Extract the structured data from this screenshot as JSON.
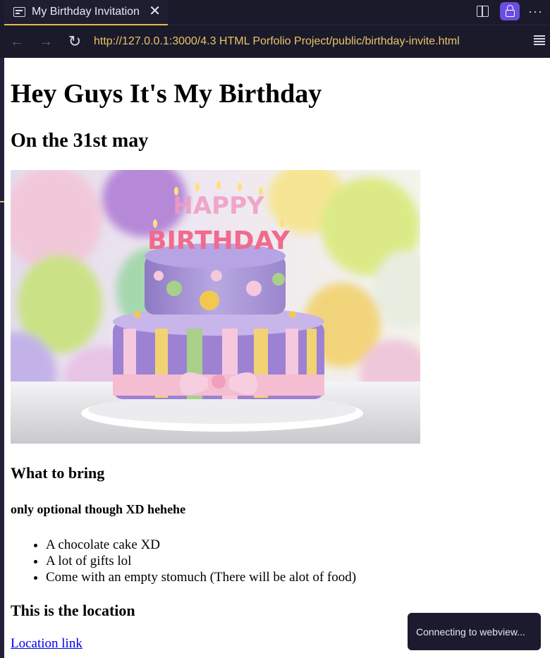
{
  "tab": {
    "icon": "preview-icon",
    "title": "My Birthday Invitation"
  },
  "toolbar": {
    "close_symbol": "✕",
    "more_symbol": "···"
  },
  "address": {
    "url": "http://127.0.0.1:3000/4.3 HTML Porfolio Project/public/birthday-invite.html"
  },
  "page": {
    "heading": "Hey Guys It's My Birthday",
    "date_heading": "On the 31st may",
    "bring_heading": "What to bring",
    "bring_note": "only optional though XD hehehe",
    "items": [
      "A chocolate cake XD",
      "A lot of gifts lol",
      "Come with an empty stomuch (There will be alot of food)"
    ],
    "location_heading": "This is the location",
    "location_link": "Location link",
    "image_text": "HAPPY BIRTHDAY"
  },
  "toast": {
    "message": "Connecting to webview..."
  },
  "colors": {
    "accent": "#e9b949",
    "lock_button": "#6b4de0",
    "url_text": "#e9c466",
    "chrome_bg": "#1b1a2b"
  }
}
